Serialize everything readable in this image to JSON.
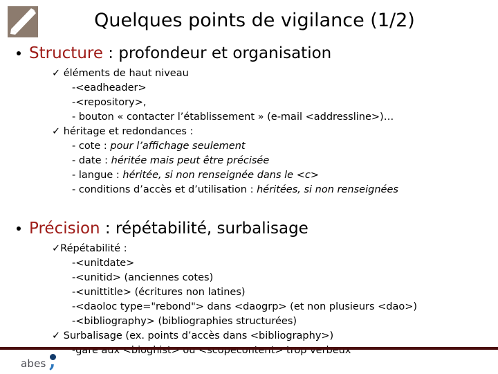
{
  "header": {
    "title": "Quelques points de vigilance (1/2)",
    "logo_icon": "abes-diagonal-banner-icon"
  },
  "footer": {
    "brand": "abes",
    "rule_color": "#4a0d0d",
    "dot_color": "#123a6b",
    "comma_color": "#2b76bd"
  },
  "colors": {
    "keyword_red": "#9e1b17",
    "logo_taupe": "#8c7b6e",
    "text_black": "#000000"
  },
  "glyphs": {
    "tick": "✓",
    "dash": "-",
    "bullet": "•"
  },
  "sections": [
    {
      "heading_keyword": "Structure",
      "heading_rest": " : profondeur et organisation",
      "groups": [
        {
          "label": "✓ éléments de haut niveau",
          "items": [
            "-<eadheader>",
            "-<repository>,",
            "- bouton « contacter l’établissement » (e-mail <addressline>)…"
          ]
        },
        {
          "label": "✓ héritage et redondances :",
          "rows": [
            {
              "plain": "- cote : ",
              "italic": "pour l’affichage seulement"
            },
            {
              "plain": "- date : ",
              "italic": "héritée mais peut être précisée"
            },
            {
              "plain": "- langue : ",
              "italic": "héritée, si non renseignée dans le <c>"
            },
            {
              "plain": "- conditions d’accès et d’utilisation : ",
              "italic": "héritées, si non renseignées"
            }
          ]
        }
      ]
    },
    {
      "heading_keyword": "Précision",
      "heading_rest": " : répétabilité, surbalisage",
      "groups": [
        {
          "label": "✓Répétabilité :",
          "items": [
            "-<unitdate>",
            "-<unitid> (anciennes cotes)",
            "-<unittitle> (écritures non latines)",
            "-<daoloc type=\"rebond\"> dans <daogrp> (et non plusieurs <dao>)",
            "-<bibliography> (bibliographies structurées)"
          ]
        },
        {
          "label": "✓ Surbalisage (ex. points d’accès dans <bibliography>)",
          "items": [
            "-gare aux <bioghist> ou <scopecontent> trop verbeux"
          ]
        }
      ]
    }
  ]
}
